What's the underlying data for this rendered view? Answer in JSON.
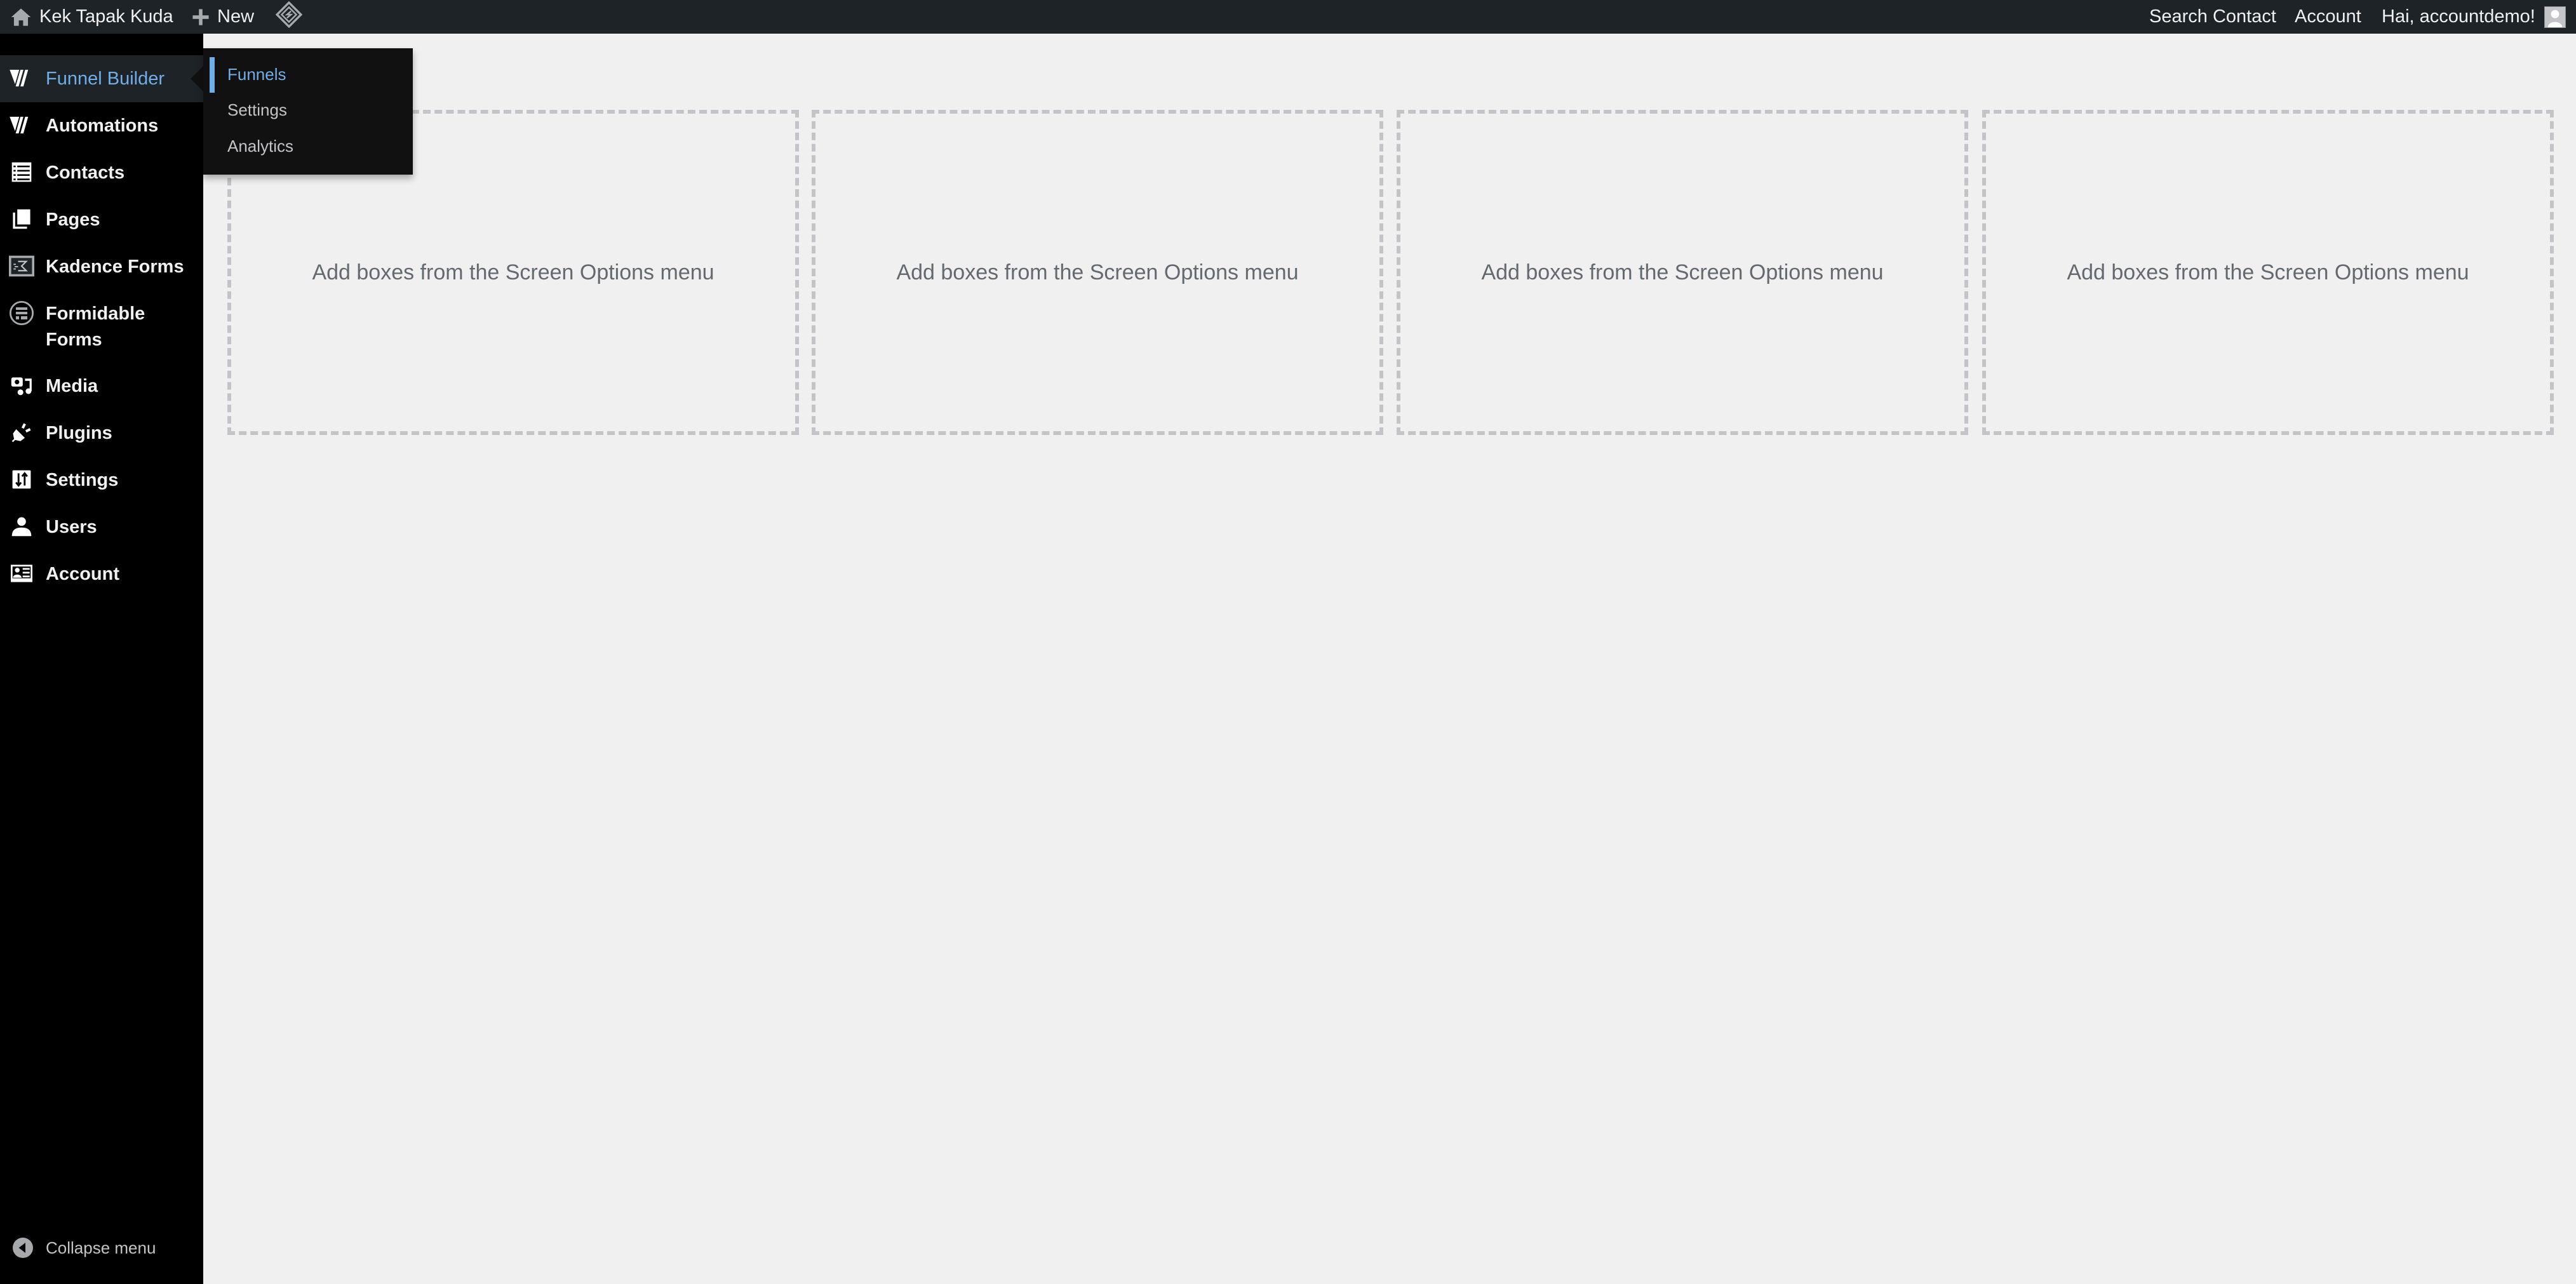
{
  "adminbar": {
    "site_name": "Kek Tapak Kuda",
    "new_label": "New",
    "right_items": [
      "Search Contact",
      "Account"
    ],
    "greeting": "Hai, accountdemo!",
    "icons": {
      "home": "home-icon",
      "new": "plus-icon",
      "plugin": "diamond-logo-icon",
      "avatar": "avatar-icon"
    }
  },
  "sidebar": {
    "items": [
      {
        "label": "Funnel Builder",
        "icon": "funnelkit-logo-icon",
        "current": true
      },
      {
        "label": "Automations",
        "icon": "funnelkit-logo-icon"
      },
      {
        "label": "Contacts",
        "icon": "list-icon"
      },
      {
        "label": "Pages",
        "icon": "pages-icon"
      },
      {
        "label": "Kadence Forms",
        "icon": "kadence-icon"
      },
      {
        "label": "Formidable Forms",
        "icon": "formidable-icon"
      },
      {
        "label": "Media",
        "icon": "media-icon"
      },
      {
        "label": "Plugins",
        "icon": "plugin-icon"
      },
      {
        "label": "Settings",
        "icon": "settings-icon"
      },
      {
        "label": "Users",
        "icon": "users-icon"
      },
      {
        "label": "Account",
        "icon": "id-card-icon"
      }
    ],
    "collapse_label": "Collapse menu"
  },
  "flyout": {
    "items": [
      {
        "label": "Funnels",
        "active": true
      },
      {
        "label": "Settings"
      },
      {
        "label": "Analytics"
      }
    ]
  },
  "main": {
    "boxes": [
      {
        "text": "Add boxes from the Screen Options menu"
      },
      {
        "text": "Add boxes from the Screen Options menu"
      },
      {
        "text": "Add boxes from the Screen Options menu"
      },
      {
        "text": "Add boxes from the Screen Options menu"
      }
    ]
  },
  "colors": {
    "accent": "#72aee6",
    "adminbar": "#1d2327",
    "sidebar": "#000000",
    "background": "#f0f0f1"
  }
}
